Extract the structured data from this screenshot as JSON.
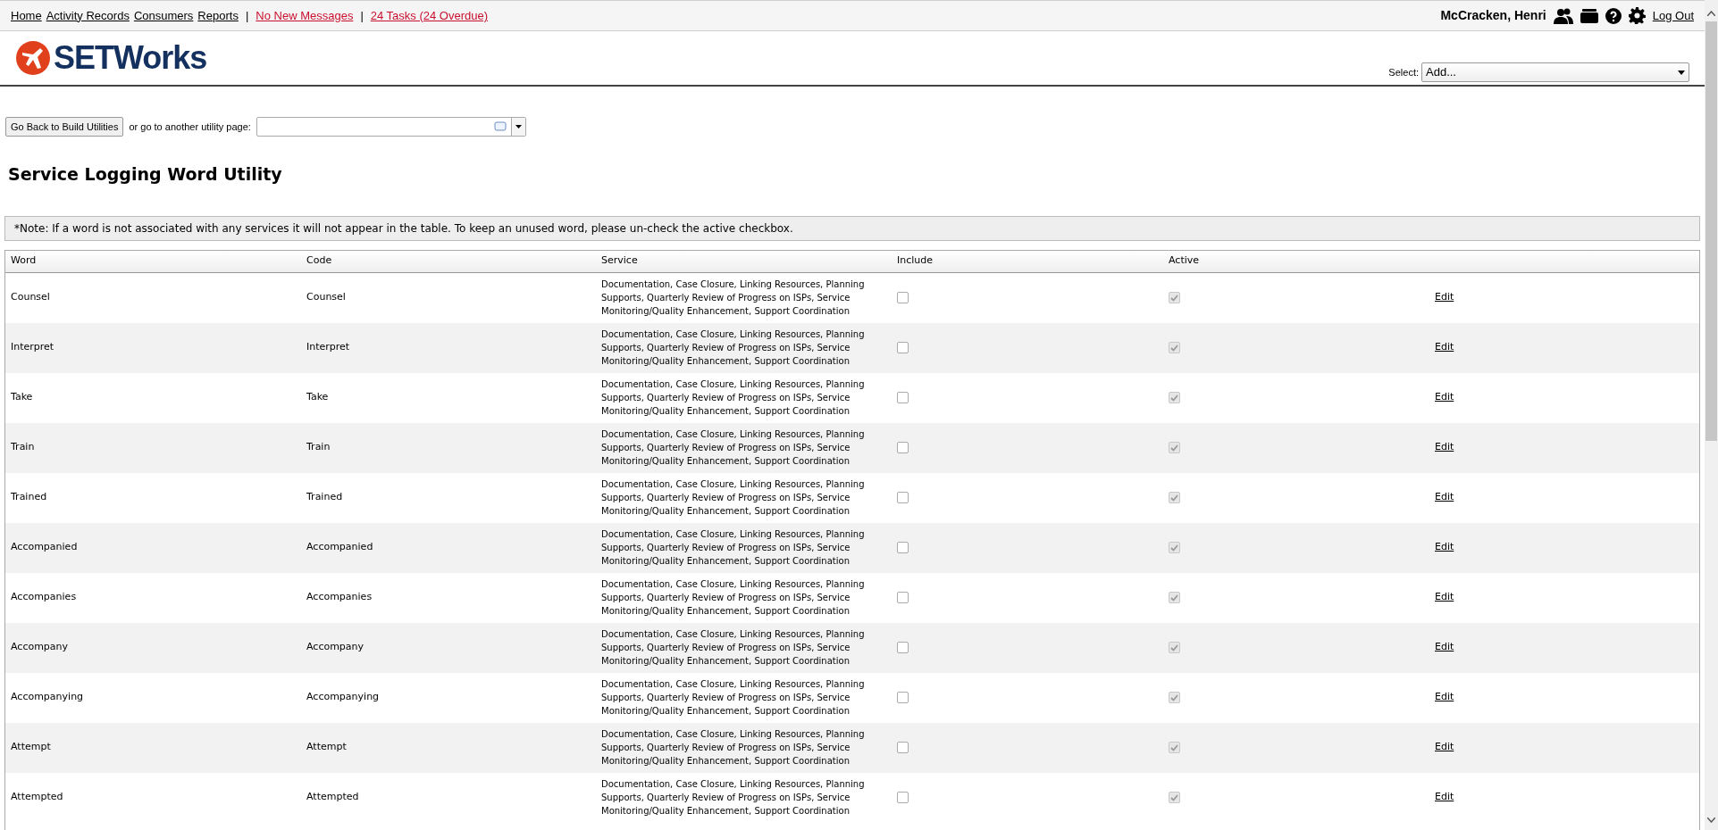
{
  "top_nav": {
    "links": [
      {
        "label": "Home",
        "alert": false
      },
      {
        "label": "Activity Records",
        "alert": false
      },
      {
        "label": "Consumers",
        "alert": false
      },
      {
        "label": "Reports",
        "alert": false
      },
      {
        "label": "No New Messages",
        "alert": true
      },
      {
        "label": "24 Tasks (24 Overdue)",
        "alert": true
      }
    ],
    "separator": "|",
    "user": "McCracken, Henri",
    "logout": "Log Out"
  },
  "logo": {
    "text": "SETWorks"
  },
  "select": {
    "label": "Select:",
    "value": "Add..."
  },
  "back_button": "Go Back to Build Utilities",
  "utility_label": "or go to another utility page:",
  "title": "Service Logging Word Utility",
  "note": "*Note: If a word is not associated with any services it will not appear in the table. To keep an unused word, please un-check the active checkbox.",
  "table": {
    "columns": [
      "Word",
      "Code",
      "Service",
      "Include",
      "Active"
    ],
    "rows": [
      {
        "word": "Counsel",
        "code": "Counsel",
        "service": "Documentation, Case Closure, Linking Resources, Planning Supports, Quarterly Review of Progress on ISPs, Service Monitoring/Quality Enhancement, Support Coordination",
        "include": false,
        "active": true,
        "active_disabled": true,
        "action": "Edit"
      },
      {
        "word": "Interpret",
        "code": "Interpret",
        "service": "Documentation, Case Closure, Linking Resources, Planning Supports, Quarterly Review of Progress on ISPs, Service Monitoring/Quality Enhancement, Support Coordination",
        "include": false,
        "active": true,
        "active_disabled": true,
        "action": "Edit"
      },
      {
        "word": "Take",
        "code": "Take",
        "service": "Documentation, Case Closure, Linking Resources, Planning Supports, Quarterly Review of Progress on ISPs, Service Monitoring/Quality Enhancement, Support Coordination",
        "include": false,
        "active": true,
        "active_disabled": true,
        "action": "Edit"
      },
      {
        "word": "Train",
        "code": "Train",
        "service": "Documentation, Case Closure, Linking Resources, Planning Supports, Quarterly Review of Progress on ISPs, Service Monitoring/Quality Enhancement, Support Coordination",
        "include": false,
        "active": true,
        "active_disabled": true,
        "action": "Edit"
      },
      {
        "word": "Trained",
        "code": "Trained",
        "service": "Documentation, Case Closure, Linking Resources, Planning Supports, Quarterly Review of Progress on ISPs, Service Monitoring/Quality Enhancement, Support Coordination",
        "include": false,
        "active": true,
        "active_disabled": true,
        "action": "Edit"
      },
      {
        "word": "Accompanied",
        "code": "Accompanied",
        "service": "Documentation, Case Closure, Linking Resources, Planning Supports, Quarterly Review of Progress on ISPs, Service Monitoring/Quality Enhancement, Support Coordination",
        "include": false,
        "active": true,
        "active_disabled": true,
        "action": "Edit"
      },
      {
        "word": "Accompanies",
        "code": "Accompanies",
        "service": "Documentation, Case Closure, Linking Resources, Planning Supports, Quarterly Review of Progress on ISPs, Service Monitoring/Quality Enhancement, Support Coordination",
        "include": false,
        "active": true,
        "active_disabled": true,
        "action": "Edit"
      },
      {
        "word": "Accompany",
        "code": "Accompany",
        "service": "Documentation, Case Closure, Linking Resources, Planning Supports, Quarterly Review of Progress on ISPs, Service Monitoring/Quality Enhancement, Support Coordination",
        "include": false,
        "active": true,
        "active_disabled": true,
        "action": "Edit"
      },
      {
        "word": "Accompanying",
        "code": "Accompanying",
        "service": "Documentation, Case Closure, Linking Resources, Planning Supports, Quarterly Review of Progress on ISPs, Service Monitoring/Quality Enhancement, Support Coordination",
        "include": false,
        "active": true,
        "active_disabled": true,
        "action": "Edit"
      },
      {
        "word": "Attempt",
        "code": "Attempt",
        "service": "Documentation, Case Closure, Linking Resources, Planning Supports, Quarterly Review of Progress on ISPs, Service Monitoring/Quality Enhancement, Support Coordination",
        "include": false,
        "active": true,
        "active_disabled": true,
        "action": "Edit"
      },
      {
        "word": "Attempted",
        "code": "Attempted",
        "service": "Documentation, Case Closure, Linking Resources, Planning Supports, Quarterly Review of Progress on ISPs, Service Monitoring/Quality Enhancement, Support Coordination",
        "include": false,
        "active": true,
        "active_disabled": true,
        "action": "Edit"
      }
    ]
  }
}
